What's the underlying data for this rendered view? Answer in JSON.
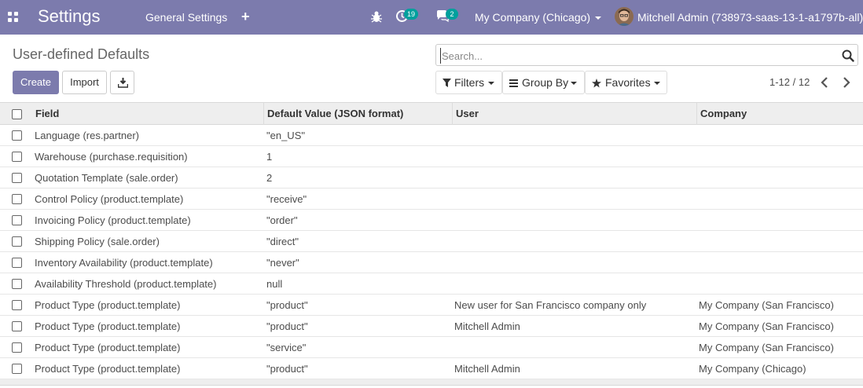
{
  "navbar": {
    "app_title": "Settings",
    "menu_general": "General Settings",
    "menu_plus": "+",
    "activity_count": "19",
    "messages_count": "2",
    "company": "My Company (Chicago)",
    "user": "Mitchell Admin (738973-saas-13-1-a1797b-all)",
    "color": "#7c7bad",
    "badge_color": "#00a09d"
  },
  "control_panel": {
    "title": "User-defined Defaults",
    "create_label": "Create",
    "import_label": "Import",
    "search_placeholder": "Search...",
    "filters_label": "Filters",
    "groupby_label": "Group By",
    "favorites_label": "Favorites",
    "pager": "1-12 / 12"
  },
  "table": {
    "headers": {
      "field": "Field",
      "value": "Default Value (JSON format)",
      "user": "User",
      "company": "Company"
    },
    "rows": [
      {
        "field": "Language (res.partner)",
        "value": "\"en_US\"",
        "user": "",
        "company": ""
      },
      {
        "field": "Warehouse (purchase.requisition)",
        "value": "1",
        "user": "",
        "company": ""
      },
      {
        "field": "Quotation Template (sale.order)",
        "value": "2",
        "user": "",
        "company": ""
      },
      {
        "field": "Control Policy (product.template)",
        "value": "\"receive\"",
        "user": "",
        "company": ""
      },
      {
        "field": "Invoicing Policy (product.template)",
        "value": "\"order\"",
        "user": "",
        "company": ""
      },
      {
        "field": "Shipping Policy (sale.order)",
        "value": "\"direct\"",
        "user": "",
        "company": ""
      },
      {
        "field": "Inventory Availability (product.template)",
        "value": "\"never\"",
        "user": "",
        "company": ""
      },
      {
        "field": "Availability Threshold (product.template)",
        "value": "null",
        "user": "",
        "company": ""
      },
      {
        "field": "Product Type (product.template)",
        "value": "\"product\"",
        "user": "New user for San Francisco company only",
        "company": "My Company (San Francisco)"
      },
      {
        "field": "Product Type (product.template)",
        "value": "\"product\"",
        "user": "Mitchell Admin",
        "company": "My Company (San Francisco)"
      },
      {
        "field": "Product Type (product.template)",
        "value": "\"service\"",
        "user": "",
        "company": "My Company (San Francisco)"
      },
      {
        "field": "Product Type (product.template)",
        "value": "\"product\"",
        "user": "Mitchell Admin",
        "company": "My Company (Chicago)"
      }
    ]
  }
}
